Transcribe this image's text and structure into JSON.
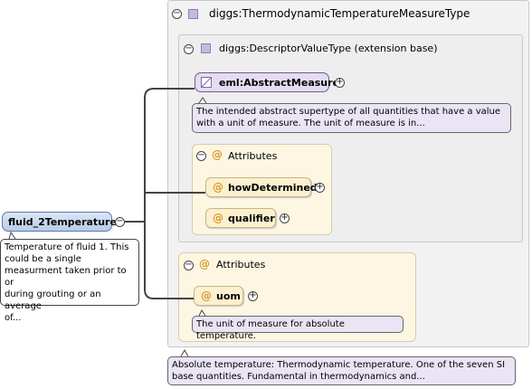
{
  "root": {
    "name": "fluid_2Temperature",
    "doc": [
      "Temperature of fluid 1. This",
      "could be a single",
      "measurment taken prior to or",
      "during grouting or an average",
      "of..."
    ]
  },
  "type_box": {
    "title": "diggs:ThermodynamicTemperatureMeasureType",
    "doc": [
      "Absolute temperature: Thermodynamic temperature. One of the seven SI",
      "base quantities. Fundamental in thermodynamics and..."
    ]
  },
  "extension": {
    "title": "diggs:DescriptorValueType (extension base)",
    "abstract_name": "eml:AbstractMeasure",
    "abstract_doc": [
      "The intended abstract supertype of all quantities that have a value",
      "with a unit of measure. The unit of measure is in..."
    ],
    "attributes_title": "Attributes",
    "attributes": [
      "howDetermined",
      "qualifier"
    ]
  },
  "own_attributes": {
    "title": "Attributes",
    "attr": "uom",
    "attr_doc": "The unit of measure for absolute temperature."
  },
  "icons": {
    "collapse": "−",
    "expand": "+",
    "attribute": "@"
  },
  "colors": {
    "root_pill": "#b8cbe8",
    "abstract_pill": "#e4dcf1",
    "attribute_pill": "#fcf0cf",
    "attribute_icon": "#d89b2e"
  }
}
